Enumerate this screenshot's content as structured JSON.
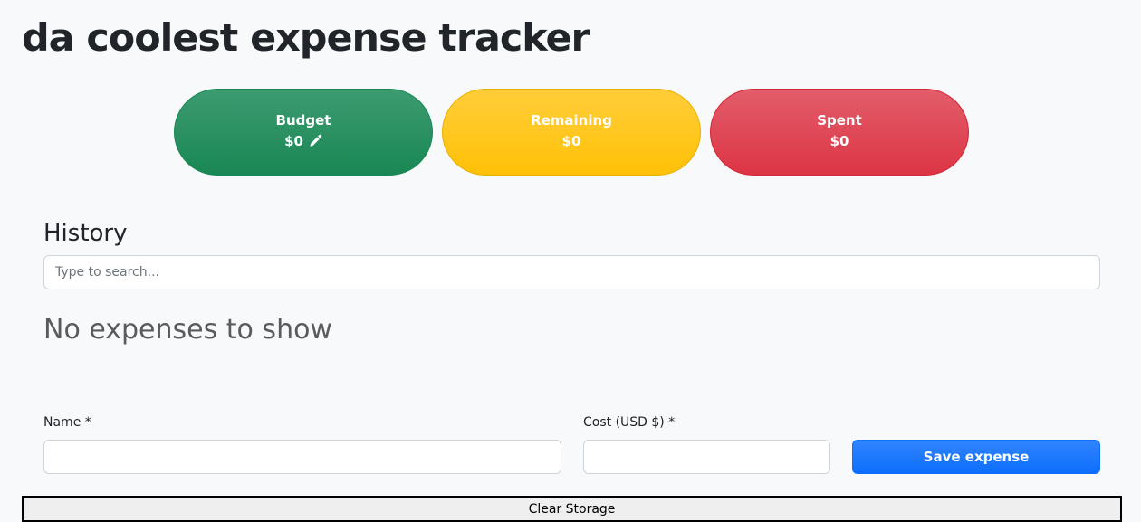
{
  "app": {
    "title": "da coolest expense tracker"
  },
  "summary": {
    "budget": {
      "label": "Budget",
      "value": "$0"
    },
    "remaining": {
      "label": "Remaining",
      "value": "$0"
    },
    "spent": {
      "label": "Spent",
      "value": "$0"
    }
  },
  "history": {
    "title": "History",
    "search_placeholder": "Type to search...",
    "empty_message": "No expenses to show"
  },
  "form": {
    "name_label": "Name *",
    "name_value": "",
    "cost_label": "Cost (USD $) *",
    "cost_value": "",
    "save_label": "Save expense"
  },
  "clear_storage_label": "Clear Storage",
  "colors": {
    "budget": "#198754",
    "remaining": "#ffc107",
    "spent": "#dc3545",
    "primary": "#0d6efd"
  }
}
